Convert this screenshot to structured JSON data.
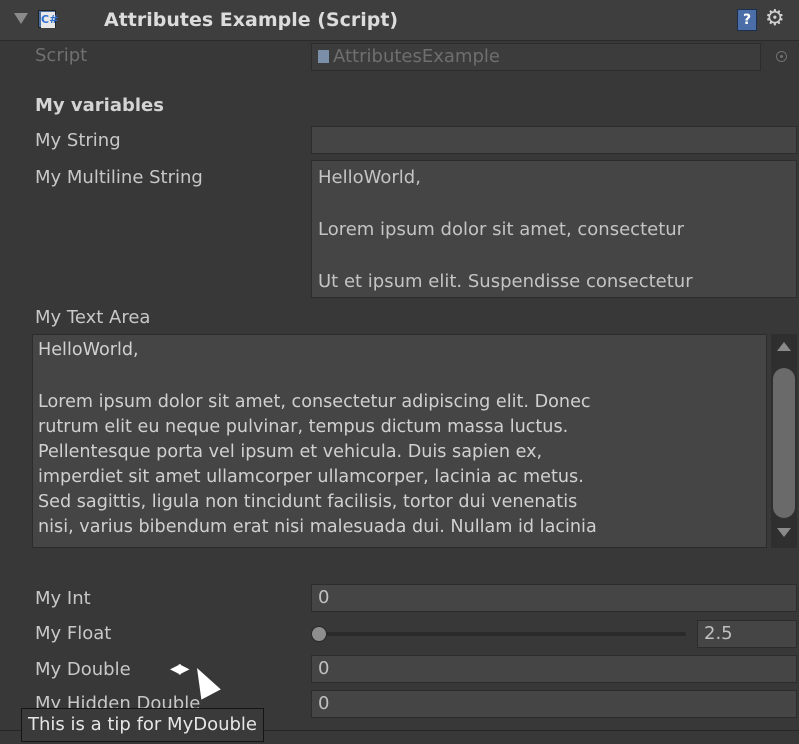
{
  "header": {
    "title": "Attributes Example (Script)",
    "icon": "csharp-script-icon",
    "cs_glyph": "C#",
    "help_glyph": "?",
    "gear_glyph": "⚙"
  },
  "script_row": {
    "label": "Script",
    "value": "AttributesExample"
  },
  "section": {
    "header": "My variables"
  },
  "fields": {
    "my_string": {
      "label": "My String",
      "value": ""
    },
    "my_multiline": {
      "label": "My Multiline String",
      "lines": [
        "HelloWorld,",
        "",
        "Lorem ipsum dolor sit amet, consectetur ",
        "",
        "Ut et ipsum elit. Suspendisse consectetur"
      ]
    },
    "my_text_area": {
      "label": "My Text Area",
      "lines": [
        "HelloWorld,",
        "",
        "Lorem ipsum dolor sit amet, consectetur adipiscing elit. Donec",
        "rutrum elit eu neque pulvinar, tempus dictum massa luctus.",
        "Pellentesque porta vel ipsum et vehicula. Duis sapien ex,",
        "imperdiet sit amet ullamcorper ullamcorper, lacinia ac metus.",
        "Sed sagittis, ligula non tincidunt facilisis, tortor dui venenatis",
        "nisi, varius bibendum erat nisi malesuada dui. Nullam id lacinia"
      ]
    },
    "my_int": {
      "label": "My Int",
      "value": "0"
    },
    "my_float": {
      "label": "My Float",
      "value": "2.5",
      "slider_fraction": 0.0
    },
    "my_double": {
      "label": "My Double",
      "value": "0"
    },
    "my_hidden_double": {
      "label": "My Hidden Double",
      "value": "0"
    }
  },
  "tooltip": {
    "text": "This is a tip for MyDouble"
  },
  "colors": {
    "background": "#383838",
    "field": "#454545",
    "header": "#3e3e3e"
  }
}
